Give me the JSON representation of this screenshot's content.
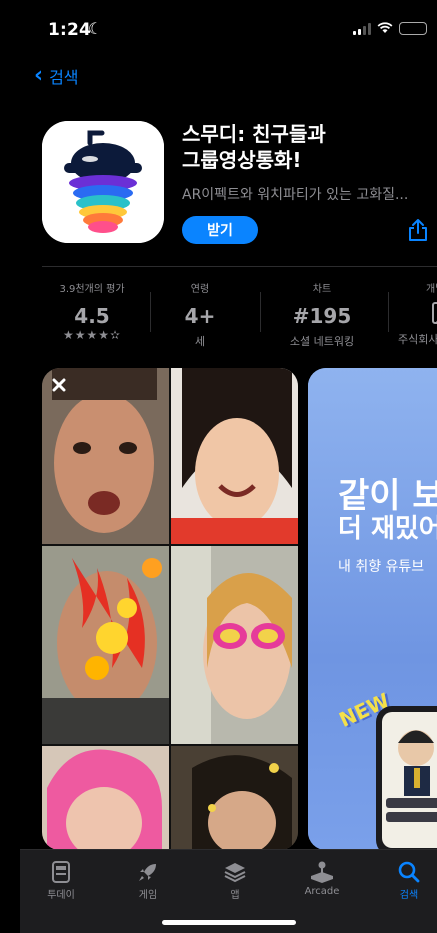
{
  "status": {
    "time": "1:24"
  },
  "nav": {
    "back_label": "검색"
  },
  "app": {
    "title_line1": "스무디: 친구들과",
    "title_line2": "그룹영상통화!",
    "subtitle": "AR이펙트와 워치파티가 있는 고화질...",
    "get_label": "받기"
  },
  "info": {
    "ratings_caption": "3.9천개의 평가",
    "rating_value": "4.5",
    "stars": "★★★★✫",
    "age_caption": "연령",
    "age_value": "4+",
    "age_sub": "세",
    "chart_caption": "차트",
    "chart_value": "#195",
    "chart_sub": "소셜 네트워킹",
    "dev_caption": "개발자",
    "dev_sub": "주식회사 ㅅ"
  },
  "screenshot2": {
    "headline1": "같이 보",
    "headline2": "더 재밌어",
    "tagline": "내 취향 유튜브",
    "badge": "NEW"
  },
  "tabs": [
    {
      "label": "투데이",
      "icon": "today-icon"
    },
    {
      "label": "게임",
      "icon": "rocket-icon"
    },
    {
      "label": "앱",
      "icon": "layers-icon"
    },
    {
      "label": "Arcade",
      "icon": "arcade-icon"
    },
    {
      "label": "검색",
      "icon": "search-icon"
    }
  ],
  "colors": {
    "accent": "#0a84ff",
    "background": "#000000"
  }
}
